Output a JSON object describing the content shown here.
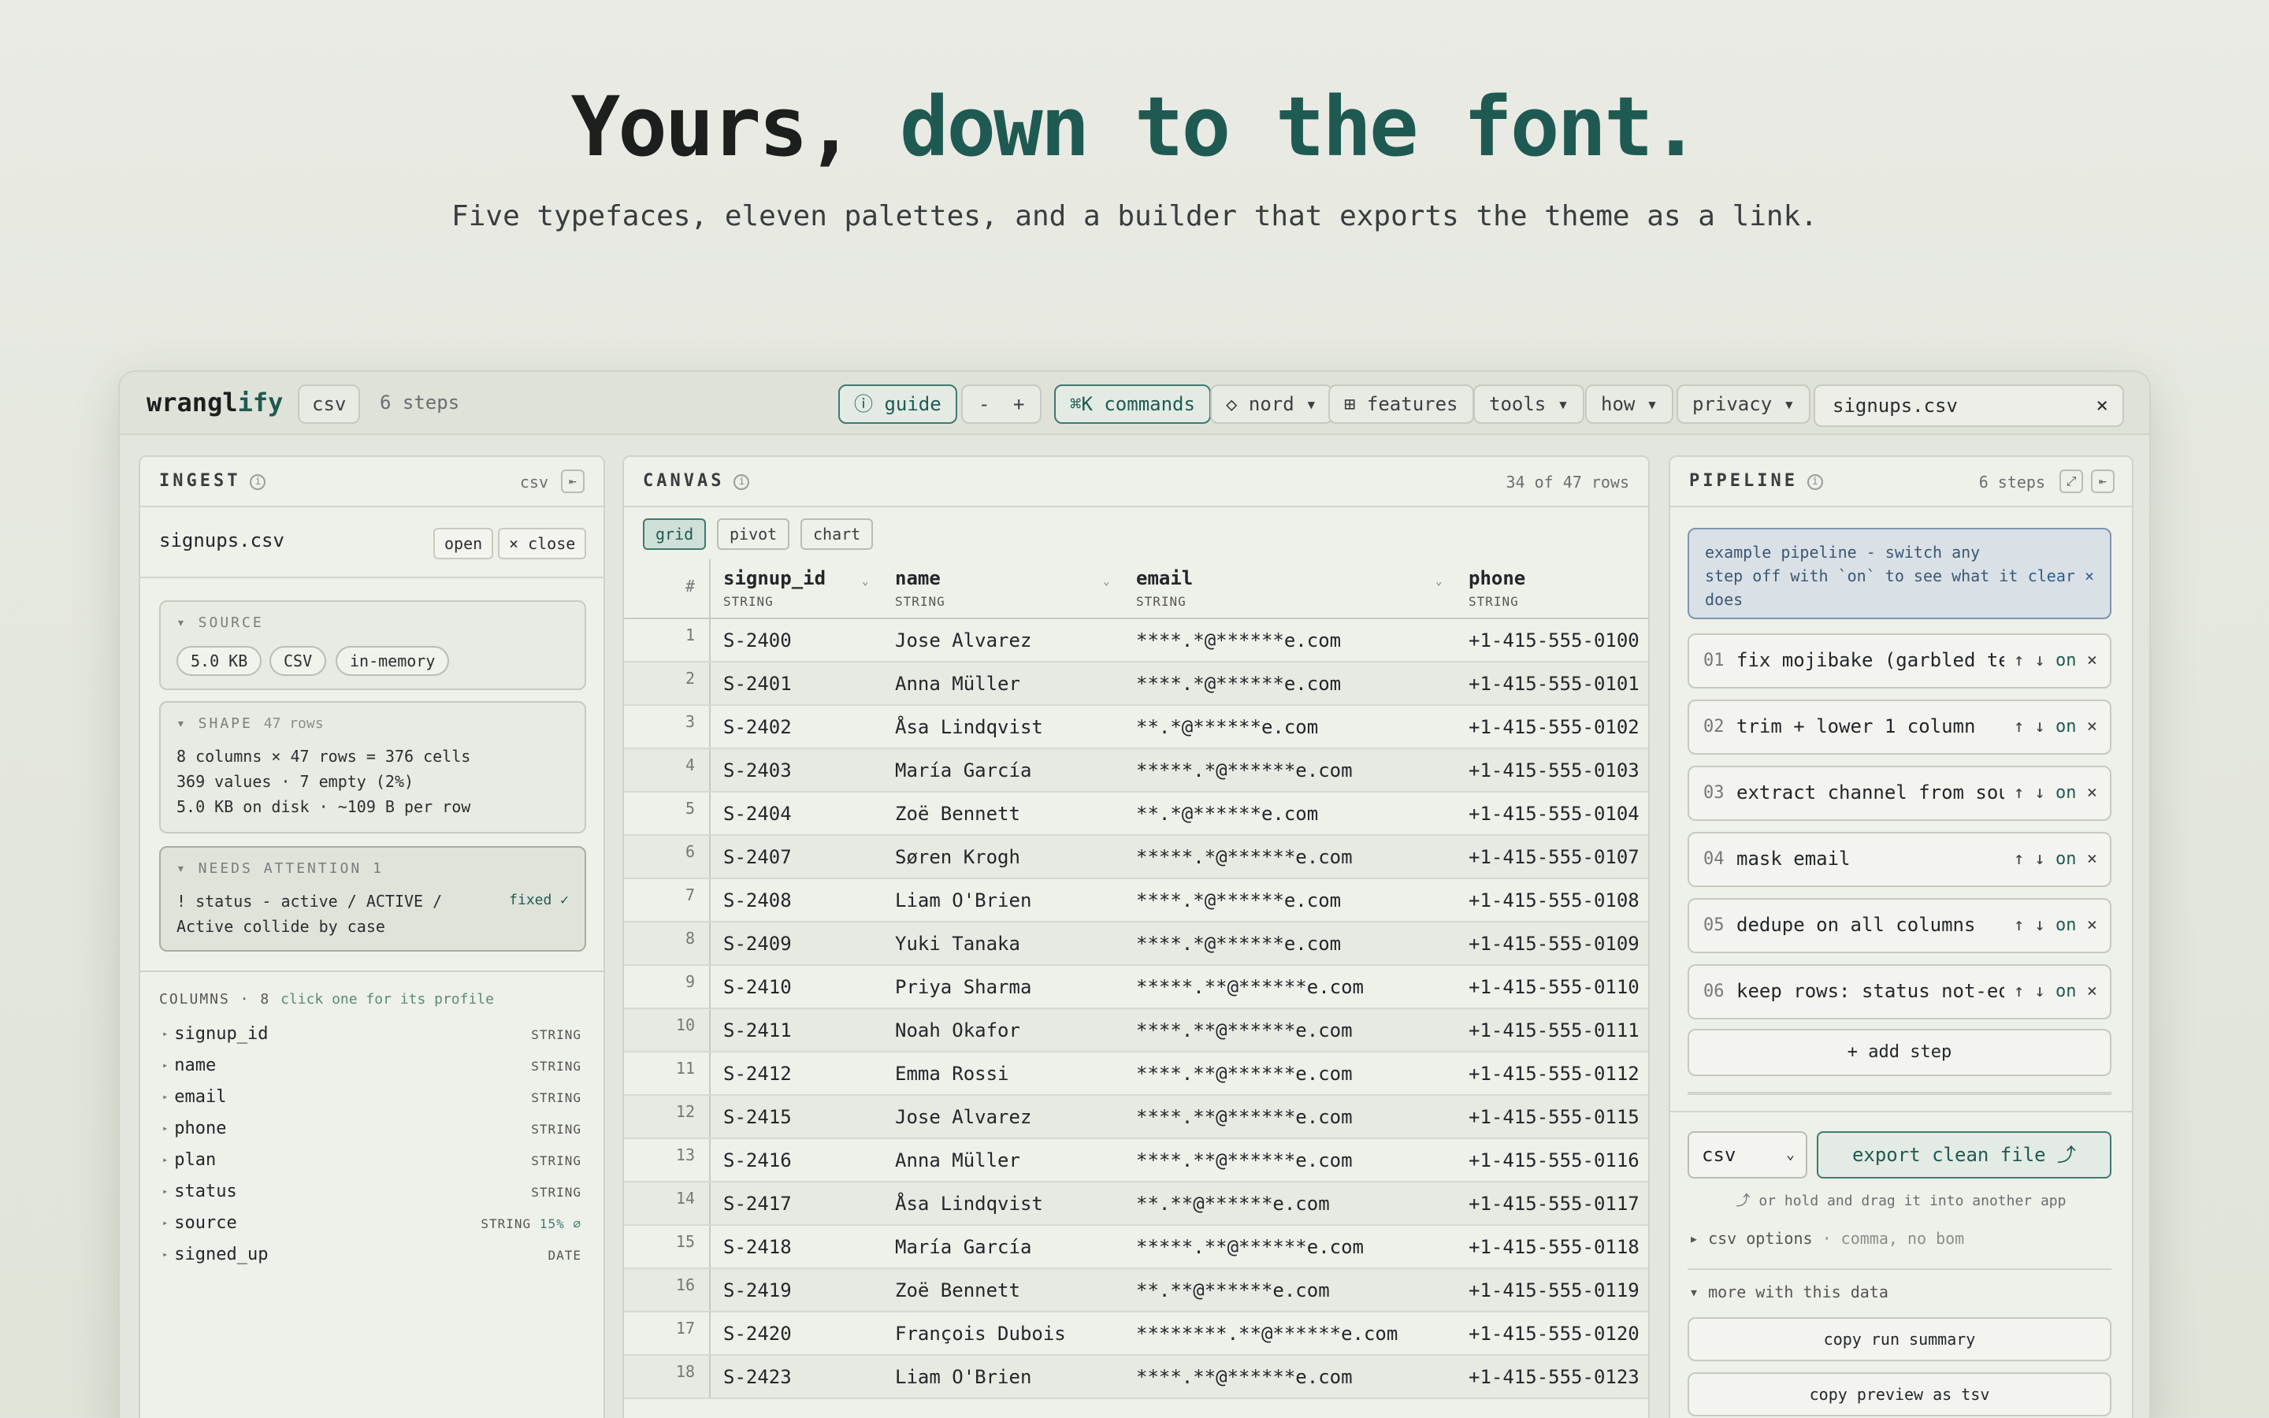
{
  "hero": {
    "title_main": "Yours, ",
    "title_accent": "down to the font.",
    "subtitle": "Five typefaces, eleven palettes, and a builder that exports the theme as a link."
  },
  "topbar": {
    "logo_main": "wrangl",
    "logo_accent": "ify",
    "format_badge": "csv",
    "steps_count": "6 steps",
    "guide": "ⓘ guide",
    "zoom_out": "-",
    "zoom_in": "+",
    "commands": "⌘K commands",
    "theme": "◇ nord ▾",
    "features": "⊞ features",
    "tools": "tools ▾",
    "how": "how ▾",
    "privacy": "privacy ▾",
    "file_name": "signups.csv",
    "file_close": "×"
  },
  "ingest": {
    "title": "INGEST",
    "format": "csv",
    "collapse": "⇤",
    "file": "signups.csv",
    "open": "open",
    "close": "× close",
    "source_h": "▾ SOURCE",
    "source_chips": [
      "5.0 KB",
      "CSV",
      "in-memory"
    ],
    "shape_h": "▾ SHAPE",
    "shape_rows": "47 rows",
    "shape_lines": [
      "8 columns × 47 rows = 376 cells",
      "369 values · 7 empty (2%)",
      "5.0 KB on disk · ~109 B per row"
    ],
    "attention_h": "▾ NEEDS ATTENTION 1",
    "attention_line1": "! status - active / ACTIVE /",
    "attention_line2": "Active collide by case",
    "attention_fixed": "fixed ✓",
    "columns_h": "COLUMNS · 8",
    "columns_hint": "click one for its profile",
    "columns": [
      {
        "name": "signup_id",
        "type": "STRING"
      },
      {
        "name": "name",
        "type": "STRING"
      },
      {
        "name": "email",
        "type": "STRING"
      },
      {
        "name": "phone",
        "type": "STRING"
      },
      {
        "name": "plan",
        "type": "STRING"
      },
      {
        "name": "status",
        "type": "STRING"
      },
      {
        "name": "source",
        "type": "STRING",
        "extra": "15% ⌀"
      },
      {
        "name": "signed_up",
        "type": "DATE"
      }
    ]
  },
  "canvas": {
    "title": "CANVAS",
    "rows_info": "34 of 47 rows",
    "tabs": [
      "grid",
      "pivot",
      "chart"
    ],
    "headers": [
      {
        "name": "signup_id",
        "type": "STRING"
      },
      {
        "name": "name",
        "type": "STRING"
      },
      {
        "name": "email",
        "type": "STRING"
      },
      {
        "name": "phone",
        "type": "STRING"
      }
    ],
    "hash": "#",
    "sort": "⌄",
    "rows": [
      [
        "1",
        "S-2400",
        "Jose Alvarez",
        "****.*@******e.com",
        "+1-415-555-0100"
      ],
      [
        "2",
        "S-2401",
        "Anna Müller",
        "****.*@******e.com",
        "+1-415-555-0101"
      ],
      [
        "3",
        "S-2402",
        "Åsa Lindqvist",
        "**.*@******e.com",
        "+1-415-555-0102"
      ],
      [
        "4",
        "S-2403",
        "María García",
        "*****.*@******e.com",
        "+1-415-555-0103"
      ],
      [
        "5",
        "S-2404",
        "Zoë Bennett",
        "**.*@******e.com",
        "+1-415-555-0104"
      ],
      [
        "6",
        "S-2407",
        "Søren Krogh",
        "*****.*@******e.com",
        "+1-415-555-0107"
      ],
      [
        "7",
        "S-2408",
        "Liam O'Brien",
        "****.*@******e.com",
        "+1-415-555-0108"
      ],
      [
        "8",
        "S-2409",
        "Yuki Tanaka",
        "****.*@******e.com",
        "+1-415-555-0109"
      ],
      [
        "9",
        "S-2410",
        "Priya Sharma",
        "*****.**@******e.com",
        "+1-415-555-0110"
      ],
      [
        "10",
        "S-2411",
        "Noah Okafor",
        "****.**@******e.com",
        "+1-415-555-0111"
      ],
      [
        "11",
        "S-2412",
        "Emma Rossi",
        "****.**@******e.com",
        "+1-415-555-0112"
      ],
      [
        "12",
        "S-2415",
        "Jose Alvarez",
        "****.**@******e.com",
        "+1-415-555-0115"
      ],
      [
        "13",
        "S-2416",
        "Anna Müller",
        "****.**@******e.com",
        "+1-415-555-0116"
      ],
      [
        "14",
        "S-2417",
        "Åsa Lindqvist",
        "**.**@******e.com",
        "+1-415-555-0117"
      ],
      [
        "15",
        "S-2418",
        "María García",
        "*****.**@******e.com",
        "+1-415-555-0118"
      ],
      [
        "16",
        "S-2419",
        "Zoë Bennett",
        "**.**@******e.com",
        "+1-415-555-0119"
      ],
      [
        "17",
        "S-2420",
        "François Dubois",
        "********.**@******e.com",
        "+1-415-555-0120"
      ],
      [
        "18",
        "S-2423",
        "Liam O'Brien",
        "****.**@******e.com",
        "+1-415-555-0123"
      ]
    ]
  },
  "pipeline": {
    "title": "PIPELINE",
    "steps_count": "6 steps",
    "expand": "⤢",
    "collapse": "⇤",
    "banner": "example pipeline - switch any step off with `on` to see what it does",
    "banner_clear": "clear ×",
    "steps": [
      {
        "num": "01",
        "label": "fix mojibake (garbled te…"
      },
      {
        "num": "02",
        "label": "trim + lower 1 column"
      },
      {
        "num": "03",
        "label": "extract channel from sou…"
      },
      {
        "num": "04",
        "label": "mask email"
      },
      {
        "num": "05",
        "label": "dedupe on all columns"
      },
      {
        "num": "06",
        "label": "keep rows: status not-eq…"
      }
    ],
    "step_ctl_arrows": "↑ ↓",
    "step_ctl_on": "on",
    "step_ctl_x": "×",
    "add_step": "+ add step",
    "format": "csv",
    "format_chev": "⌄",
    "export": "export clean file ⤴",
    "drag_note": "⤴ or hold and drag it into another app",
    "csv_options": "▸ csv options",
    "csv_options_note": "· comma, no bom",
    "more": "▾ more with this data",
    "copy_summary": "copy run summary",
    "copy_preview": "copy preview as tsv"
  }
}
